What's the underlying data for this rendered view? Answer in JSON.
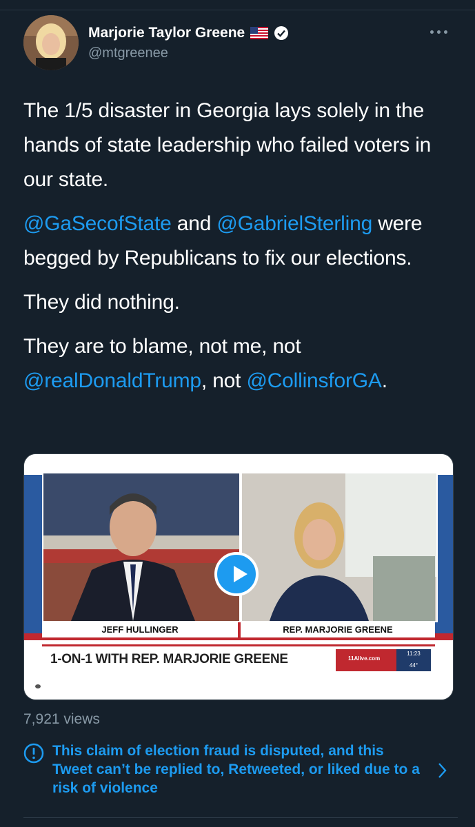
{
  "author": {
    "name": "Marjorie Taylor Greene",
    "flag_emoji_name": "us-flag-icon",
    "handle": "@mtgreenee"
  },
  "tweet": {
    "p1": "The 1/5 disaster in Georgia lays solely in the hands of state leadership who failed voters in our state.",
    "p2_mention1": "@GaSecofState",
    "p2_and": " and ",
    "p2_mention2": "@GabrielSterling",
    "p2_rest": " were begged by Republicans to fix our elections.",
    "p3": "They did nothing.",
    "p4_a": "They are to blame, not me, not ",
    "p4_mention1": "@realDonaldTrump",
    "p4_b": ", not ",
    "p4_mention2": "@CollinsforGA",
    "p4_c": "."
  },
  "video": {
    "caption_left": "JEFF HULLINGER",
    "caption_right": "REP. MARJORIE GREENE",
    "lower_third": "1-ON-1 WITH REP. MARJORIE GREENE",
    "logo": "11Alive.com",
    "time": "11:23",
    "temp": "44°"
  },
  "views": "7,921 views",
  "notice": {
    "text": "This claim of election fraud is disputed, and this Tweet can’t be replied to, Retweeted, or liked due to a risk of violence"
  },
  "colors": {
    "background": "#15202b",
    "accent": "#1d9bf0",
    "muted": "#8899a6"
  }
}
